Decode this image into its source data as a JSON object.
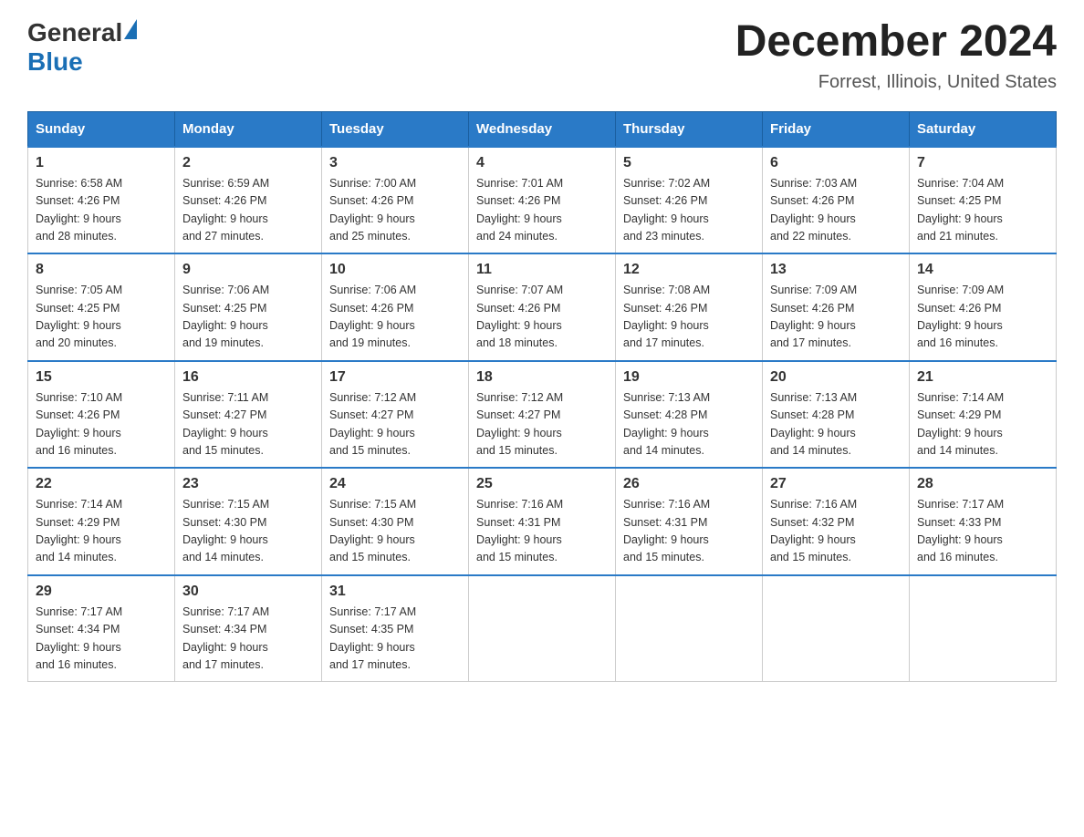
{
  "header": {
    "logo_general": "General",
    "logo_blue": "Blue",
    "title": "December 2024",
    "subtitle": "Forrest, Illinois, United States"
  },
  "days_of_week": [
    "Sunday",
    "Monday",
    "Tuesday",
    "Wednesday",
    "Thursday",
    "Friday",
    "Saturday"
  ],
  "weeks": [
    [
      {
        "day": "1",
        "sunrise": "6:58 AM",
        "sunset": "4:26 PM",
        "daylight": "9 hours and 28 minutes."
      },
      {
        "day": "2",
        "sunrise": "6:59 AM",
        "sunset": "4:26 PM",
        "daylight": "9 hours and 27 minutes."
      },
      {
        "day": "3",
        "sunrise": "7:00 AM",
        "sunset": "4:26 PM",
        "daylight": "9 hours and 25 minutes."
      },
      {
        "day": "4",
        "sunrise": "7:01 AM",
        "sunset": "4:26 PM",
        "daylight": "9 hours and 24 minutes."
      },
      {
        "day": "5",
        "sunrise": "7:02 AM",
        "sunset": "4:26 PM",
        "daylight": "9 hours and 23 minutes."
      },
      {
        "day": "6",
        "sunrise": "7:03 AM",
        "sunset": "4:26 PM",
        "daylight": "9 hours and 22 minutes."
      },
      {
        "day": "7",
        "sunrise": "7:04 AM",
        "sunset": "4:25 PM",
        "daylight": "9 hours and 21 minutes."
      }
    ],
    [
      {
        "day": "8",
        "sunrise": "7:05 AM",
        "sunset": "4:25 PM",
        "daylight": "9 hours and 20 minutes."
      },
      {
        "day": "9",
        "sunrise": "7:06 AM",
        "sunset": "4:25 PM",
        "daylight": "9 hours and 19 minutes."
      },
      {
        "day": "10",
        "sunrise": "7:06 AM",
        "sunset": "4:26 PM",
        "daylight": "9 hours and 19 minutes."
      },
      {
        "day": "11",
        "sunrise": "7:07 AM",
        "sunset": "4:26 PM",
        "daylight": "9 hours and 18 minutes."
      },
      {
        "day": "12",
        "sunrise": "7:08 AM",
        "sunset": "4:26 PM",
        "daylight": "9 hours and 17 minutes."
      },
      {
        "day": "13",
        "sunrise": "7:09 AM",
        "sunset": "4:26 PM",
        "daylight": "9 hours and 17 minutes."
      },
      {
        "day": "14",
        "sunrise": "7:09 AM",
        "sunset": "4:26 PM",
        "daylight": "9 hours and 16 minutes."
      }
    ],
    [
      {
        "day": "15",
        "sunrise": "7:10 AM",
        "sunset": "4:26 PM",
        "daylight": "9 hours and 16 minutes."
      },
      {
        "day": "16",
        "sunrise": "7:11 AM",
        "sunset": "4:27 PM",
        "daylight": "9 hours and 15 minutes."
      },
      {
        "day": "17",
        "sunrise": "7:12 AM",
        "sunset": "4:27 PM",
        "daylight": "9 hours and 15 minutes."
      },
      {
        "day": "18",
        "sunrise": "7:12 AM",
        "sunset": "4:27 PM",
        "daylight": "9 hours and 15 minutes."
      },
      {
        "day": "19",
        "sunrise": "7:13 AM",
        "sunset": "4:28 PM",
        "daylight": "9 hours and 14 minutes."
      },
      {
        "day": "20",
        "sunrise": "7:13 AM",
        "sunset": "4:28 PM",
        "daylight": "9 hours and 14 minutes."
      },
      {
        "day": "21",
        "sunrise": "7:14 AM",
        "sunset": "4:29 PM",
        "daylight": "9 hours and 14 minutes."
      }
    ],
    [
      {
        "day": "22",
        "sunrise": "7:14 AM",
        "sunset": "4:29 PM",
        "daylight": "9 hours and 14 minutes."
      },
      {
        "day": "23",
        "sunrise": "7:15 AM",
        "sunset": "4:30 PM",
        "daylight": "9 hours and 14 minutes."
      },
      {
        "day": "24",
        "sunrise": "7:15 AM",
        "sunset": "4:30 PM",
        "daylight": "9 hours and 15 minutes."
      },
      {
        "day": "25",
        "sunrise": "7:16 AM",
        "sunset": "4:31 PM",
        "daylight": "9 hours and 15 minutes."
      },
      {
        "day": "26",
        "sunrise": "7:16 AM",
        "sunset": "4:31 PM",
        "daylight": "9 hours and 15 minutes."
      },
      {
        "day": "27",
        "sunrise": "7:16 AM",
        "sunset": "4:32 PM",
        "daylight": "9 hours and 15 minutes."
      },
      {
        "day": "28",
        "sunrise": "7:17 AM",
        "sunset": "4:33 PM",
        "daylight": "9 hours and 16 minutes."
      }
    ],
    [
      {
        "day": "29",
        "sunrise": "7:17 AM",
        "sunset": "4:34 PM",
        "daylight": "9 hours and 16 minutes."
      },
      {
        "day": "30",
        "sunrise": "7:17 AM",
        "sunset": "4:34 PM",
        "daylight": "9 hours and 17 minutes."
      },
      {
        "day": "31",
        "sunrise": "7:17 AM",
        "sunset": "4:35 PM",
        "daylight": "9 hours and 17 minutes."
      },
      null,
      null,
      null,
      null
    ]
  ],
  "labels": {
    "sunrise": "Sunrise:",
    "sunset": "Sunset:",
    "daylight": "Daylight:"
  }
}
